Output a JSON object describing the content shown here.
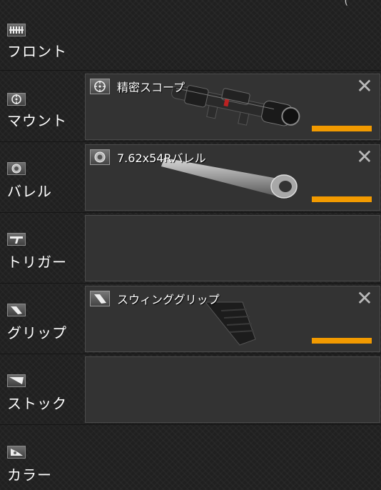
{
  "categories": [
    {
      "label": "フロント",
      "icon": "front-icon"
    },
    {
      "label": "マウント",
      "icon": "mount-icon"
    },
    {
      "label": "バレル",
      "icon": "barrel-icon"
    },
    {
      "label": "トリガー",
      "icon": "trigger-icon"
    },
    {
      "label": "グリップ",
      "icon": "grip-icon"
    },
    {
      "label": "ストック",
      "icon": "stock-icon"
    },
    {
      "label": "カラー",
      "icon": "color-icon"
    }
  ],
  "slots": {
    "mount": {
      "name": "精密スコープ",
      "icon": "scope-icon",
      "durability": 1.0
    },
    "barrel": {
      "name": "7.62x54Rバレル",
      "icon": "barrel-part-icon",
      "durability": 1.0
    },
    "grip": {
      "name": "スウィンググリップ",
      "icon": "grip-part-icon",
      "durability": 1.0
    }
  },
  "colors": {
    "accent": "#f29a00",
    "background": "#202020",
    "slot": "#333333"
  }
}
